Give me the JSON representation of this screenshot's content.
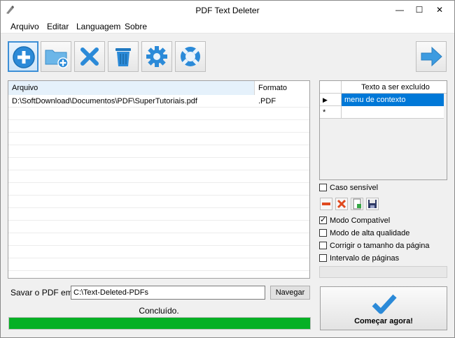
{
  "window": {
    "title": "PDF Text Deleter",
    "minimize": "—",
    "maximize": "☐",
    "close": "✕"
  },
  "menu": [
    "Arquivo",
    "Editar",
    "Languagem",
    "Sobre"
  ],
  "toolbar": {
    "buttons": [
      {
        "name": "add-file",
        "icon": "plus-circle-icon"
      },
      {
        "name": "add-folder",
        "icon": "folder-plus-icon"
      },
      {
        "name": "remove",
        "icon": "x-icon"
      },
      {
        "name": "clear",
        "icon": "trash-icon"
      },
      {
        "name": "settings",
        "icon": "gear-icon"
      },
      {
        "name": "help",
        "icon": "lifebuoy-icon"
      }
    ],
    "next": {
      "icon": "arrow-right-icon"
    }
  },
  "files": {
    "columns": [
      "Arquivo",
      "Formato"
    ],
    "rows": [
      [
        "D:\\SoftDownload\\Documentos\\PDF\\SuperTutoriais.pdf",
        ".PDF"
      ]
    ]
  },
  "texts": {
    "column": "Texto a ser excluído",
    "rows": [
      {
        "marker": "▶",
        "value": "menu de contexto"
      },
      {
        "marker": "*",
        "value": ""
      }
    ]
  },
  "options": {
    "case_sensitive": {
      "label": "Caso sensível",
      "checked": false
    },
    "compat_mode": {
      "label": "Modo Compatível",
      "checked": true
    },
    "high_quality": {
      "label": "Modo de alta qualidade",
      "checked": false
    },
    "fix_page_size": {
      "label": "Corrigir o tamanho da página",
      "checked": false
    },
    "page_range": {
      "label": "Intervalo de páginas",
      "checked": false
    }
  },
  "save": {
    "label": "Savar o PDF em",
    "value": "C:\\Text-Deleted-PDFs",
    "browse": "Navegar"
  },
  "status": {
    "text": "Concluído.",
    "progress": 1.0
  },
  "start": {
    "label": "Começar agora!"
  },
  "colors": {
    "accent": "#3d8fd6",
    "progress": "#06b025",
    "selection": "#0078d7",
    "delete": "#e04a1f"
  }
}
